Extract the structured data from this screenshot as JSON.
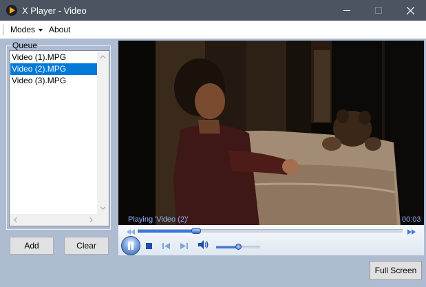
{
  "window": {
    "title": "X Player - Video",
    "controls": [
      "minimize",
      "maximize",
      "close"
    ]
  },
  "menu": {
    "modes": "Modes",
    "about": "About"
  },
  "queue": {
    "title": "Queue",
    "items": [
      "Video (1).MPG",
      "Video (2).MPG",
      "Video (3).MPG"
    ],
    "selected_index": 1,
    "add_label": "Add",
    "clear_label": "Clear"
  },
  "player": {
    "status": "Playing 'Video (2)'",
    "time": "00:03",
    "seek_position": 0.22,
    "volume": 0.5,
    "state": "playing"
  },
  "fullscreen_label": "Full Screen",
  "colors": {
    "titlebar": "#4a5561",
    "client": "#aebcd2",
    "selection": "#0078d7",
    "status_text": "#8fb5ff"
  }
}
